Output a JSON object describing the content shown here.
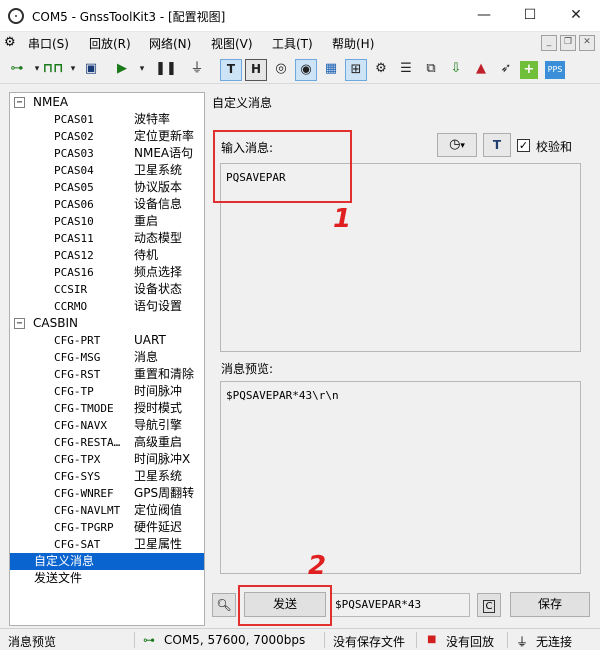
{
  "window": {
    "title": "COM5 - GnssToolKit3 - [配置视图]",
    "minimize": "—",
    "maximize": "☐",
    "close": "✕"
  },
  "menu": {
    "items": [
      "串口(S)",
      "回放(R)",
      "网络(N)",
      "视图(V)",
      "工具(T)",
      "帮助(H)"
    ]
  },
  "toolbar": {
    "icons": [
      "connect-icon",
      "signal-icon",
      "save-icon",
      "play-icon",
      "pause-icon",
      "plug-icon",
      "text-view-icon",
      "hex-view-icon",
      "target-icon",
      "fix-icon",
      "grid-icon",
      "gear-icon",
      "list-icon",
      "map-icon",
      "download-icon",
      "arrow-icon",
      "bird-icon",
      "plus-icon",
      "pps-icon"
    ],
    "t_label": "T",
    "h_label": "H",
    "pps_label": "PPS"
  },
  "tree": {
    "nmea_label": "NMEA",
    "nmea_items": [
      {
        "code": "PCAS01",
        "desc": "波特率"
      },
      {
        "code": "PCAS02",
        "desc": "定位更新率"
      },
      {
        "code": "PCAS03",
        "desc": "NMEA语句"
      },
      {
        "code": "PCAS04",
        "desc": "卫星系统"
      },
      {
        "code": "PCAS05",
        "desc": "协议版本"
      },
      {
        "code": "PCAS06",
        "desc": "设备信息"
      },
      {
        "code": "PCAS10",
        "desc": "重启"
      },
      {
        "code": "PCAS11",
        "desc": "动态模型"
      },
      {
        "code": "PCAS12",
        "desc": "待机"
      },
      {
        "code": "PCAS16",
        "desc": "频点选择"
      },
      {
        "code": "CCSIR",
        "desc": "设备状态"
      },
      {
        "code": "CCRMO",
        "desc": "语句设置"
      }
    ],
    "casbin_label": "CASBIN",
    "casbin_items": [
      {
        "code": "CFG-PRT",
        "desc": "UART"
      },
      {
        "code": "CFG-MSG",
        "desc": "消息"
      },
      {
        "code": "CFG-RST",
        "desc": "重置和清除"
      },
      {
        "code": "CFG-TP",
        "desc": "时间脉冲"
      },
      {
        "code": "CFG-TMODE",
        "desc": "授时模式"
      },
      {
        "code": "CFG-NAVX",
        "desc": "导航引擎"
      },
      {
        "code": "CFG-RESTA…",
        "desc": "高级重启"
      },
      {
        "code": "CFG-TPX",
        "desc": "时间脉冲X"
      },
      {
        "code": "CFG-SYS",
        "desc": "卫星系统"
      },
      {
        "code": "CFG-WNREF",
        "desc": "GPS周翻转"
      },
      {
        "code": "CFG-NAVLMT",
        "desc": "定位阀值"
      },
      {
        "code": "CFG-TPGRP",
        "desc": "硬件延迟"
      },
      {
        "code": "CFG-SAT",
        "desc": "卫星属性"
      }
    ],
    "custom_label": "自定义消息",
    "send_file_label": "发送文件",
    "selected_color": "#0a64d0"
  },
  "panel": {
    "title": "自定义消息",
    "input_label": "输入消息:",
    "input_value": "PQSAVEPAR",
    "checksum_label": "校验和",
    "preview_label": "消息预览:",
    "preview_value": "$PQSAVEPAR*43\\r\\n",
    "send_button": "发送",
    "send_field_value": "$PQSAVEPAR*43",
    "save_button": "保存",
    "c_button": "C"
  },
  "annotations": {
    "badge1": "1",
    "badge2": "2",
    "color": "#e23030"
  },
  "status": {
    "left": "消息预览",
    "port": "COM5, 57600, 7000bps",
    "save": "没有保存文件",
    "replay": "没有回放",
    "conn": "无连接"
  }
}
